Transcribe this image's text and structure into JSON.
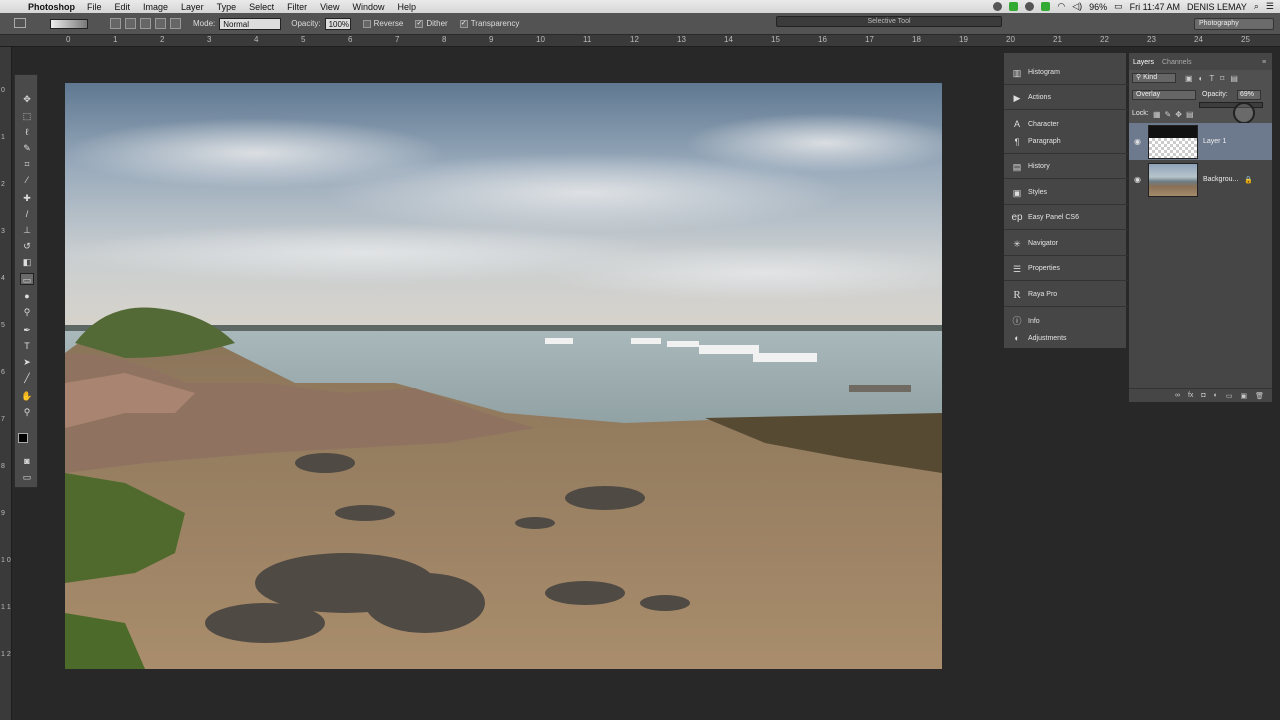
{
  "menubar": {
    "apple_icon": "apple-icon",
    "app_name": "Photoshop",
    "items": [
      "File",
      "Edit",
      "Image",
      "Layer",
      "Type",
      "Select",
      "Filter",
      "View",
      "Window",
      "Help"
    ],
    "battery": "96%",
    "clock": "Fri 11:47 AM",
    "user": "DENIS LEMAY"
  },
  "options_bar": {
    "mode_label": "Mode:",
    "mode_value": "Normal",
    "opacity_label": "Opacity:",
    "opacity_value": "100%",
    "reverse_label": "Reverse",
    "dither_label": "Dither",
    "transparency_label": "Transparency",
    "selective_tool": "Selective Tool",
    "workspace": "Photography"
  },
  "ruler": {
    "top_labels": [
      "0",
      "1",
      "2",
      "3",
      "4",
      "5",
      "6",
      "7",
      "8",
      "9",
      "10",
      "11",
      "12",
      "13",
      "14",
      "15",
      "16",
      "17",
      "18",
      "19",
      "20",
      "21",
      "22",
      "23",
      "24",
      "25"
    ],
    "left_labels": [
      "0",
      "1",
      "2",
      "3",
      "4",
      "5",
      "6",
      "7",
      "8",
      "9",
      "1\n0",
      "1\n1",
      "1\n2"
    ]
  },
  "dock_panels": [
    {
      "label": "Histogram",
      "icon": "histogram-icon"
    },
    {
      "label": "Actions",
      "icon": "play-icon"
    },
    {
      "label": "Character",
      "icon": "character-icon"
    },
    {
      "label": "Paragraph",
      "icon": "paragraph-icon"
    },
    {
      "label": "History",
      "icon": "history-icon"
    },
    {
      "label": "Styles",
      "icon": "styles-icon"
    },
    {
      "label": "Easy Panel CS6",
      "icon": "ep-icon"
    },
    {
      "label": "Navigator",
      "icon": "navigator-icon"
    },
    {
      "label": "Properties",
      "icon": "properties-icon"
    },
    {
      "label": "Raya Pro",
      "icon": "raya-icon"
    },
    {
      "label": "Info",
      "icon": "info-icon"
    },
    {
      "label": "Adjustments",
      "icon": "adjustments-icon"
    }
  ],
  "layers_panel": {
    "tabs": [
      "Layers",
      "Channels"
    ],
    "filter": "Kind",
    "blend_mode": "Overlay",
    "opacity_label": "Opacity:",
    "opacity_value": "69%",
    "lock_label": "Lock:",
    "layers": [
      {
        "name": "Layer 1",
        "selected": true
      },
      {
        "name": "Backgrou...",
        "selected": false
      }
    ]
  }
}
